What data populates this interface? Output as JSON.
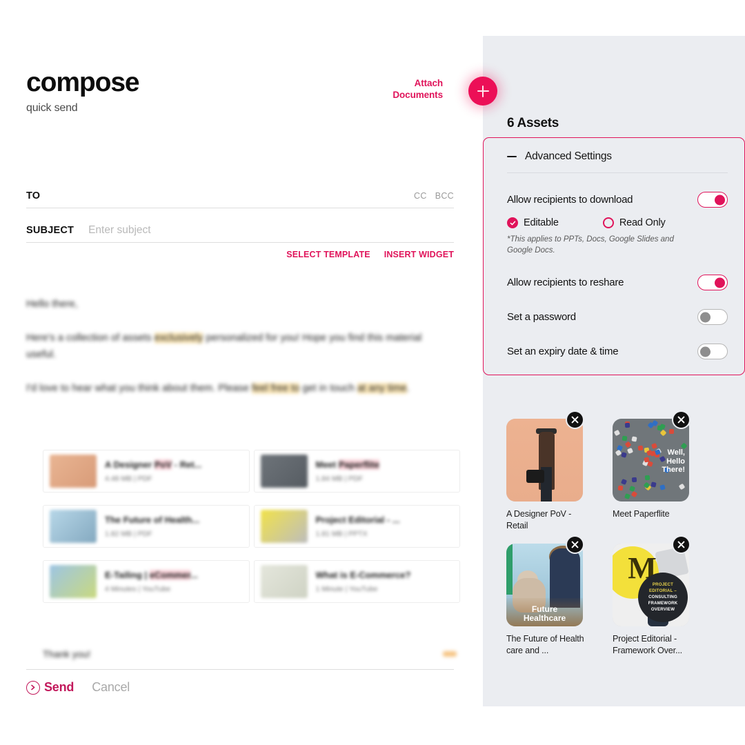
{
  "compose": {
    "title": "compose",
    "subtitle": "quick send",
    "attach": {
      "line1": "Attach",
      "line2": "Documents",
      "fab_icon": "plus-icon"
    },
    "fields": {
      "to_label": "TO",
      "to_value": "",
      "cc_label": "CC",
      "bcc_label": "BCC",
      "subject_label": "SUBJECT",
      "subject_placeholder": "Enter subject",
      "subject_value": ""
    },
    "links": {
      "select_template": "SELECT TEMPLATE",
      "insert_widget": "INSERT WIDGET"
    },
    "body": {
      "greeting": "Hello there,",
      "para1_a": "Here's a collection of assets ",
      "para1_hl": "exclusively",
      "para1_b": " personalized for you! Hope you find this material useful.",
      "para2_a": "I'd love to hear what you think about them. Please ",
      "para2_hl1": "feel free to",
      "para2_b": " get in touch ",
      "para2_hl2": "at any time",
      "para2_c": ".",
      "signoff": "Thank you!"
    },
    "mail_assets": [
      {
        "title_a": "A Designer ",
        "title_kw": "PoV",
        "title_b": " - Ret...",
        "meta": "4.48 MB | PDF"
      },
      {
        "title_a": "Meet ",
        "title_kw": "Paperflite",
        "title_b": "",
        "meta": "1.84 MB | PDF"
      },
      {
        "title_a": "The Future of Health...",
        "title_kw": "",
        "title_b": "",
        "meta": "1.82 MB | PDF"
      },
      {
        "title_a": "Project Editorial - ...",
        "title_kw": "",
        "title_b": "",
        "meta": "1.81 MB | PPTX"
      },
      {
        "title_a": "E-Tailing | ",
        "title_kw": "eCommer",
        "title_b": "...",
        "meta": "4 Minutes | YouTube"
      },
      {
        "title_a": "What is E-Commerce?",
        "title_kw": "",
        "title_b": "",
        "meta": "1 Minute | YouTube"
      }
    ],
    "actions": {
      "send": "Send",
      "cancel": "Cancel",
      "send_icon": "circle-arrow-right-icon"
    }
  },
  "panel": {
    "assets_count": "6 Assets",
    "advanced": {
      "title": "Advanced Settings",
      "collapse_icon": "minus-icon",
      "settings": [
        {
          "label": "Allow recipients to download",
          "state": "on"
        },
        {
          "label": "Allow recipients to reshare",
          "state": "on"
        },
        {
          "label": "Set a password",
          "state": "off"
        },
        {
          "label": "Set an expiry date & time",
          "state": "off"
        }
      ],
      "radios": [
        {
          "label": "Editable",
          "selected": true
        },
        {
          "label": "Read Only",
          "selected": false
        }
      ],
      "note": "*This applies to PPTs, Docs, Google Slides and Google Docs."
    },
    "assets": [
      {
        "title": "A Designer PoV - Retail",
        "remove_icon": "close-icon",
        "overlay": ""
      },
      {
        "title": "Meet Paperflite",
        "remove_icon": "close-icon",
        "overlay": "Well, Hello There!"
      },
      {
        "title": "The Future of Health care and ...",
        "remove_icon": "close-icon",
        "overlay": "Future Healthcare"
      },
      {
        "title": "Project Editorial - Framework Over...",
        "remove_icon": "close-icon",
        "overlay": "PROJECT EDITORIAL – CONSULTING FRAMEWORK OVERVIEW"
      }
    ]
  },
  "colors": {
    "accent": "#e0135a",
    "fab": "#ec0f57",
    "send": "#c2185b",
    "panel_bg": "#ebedf1",
    "highlight": "#fbe7b8"
  }
}
